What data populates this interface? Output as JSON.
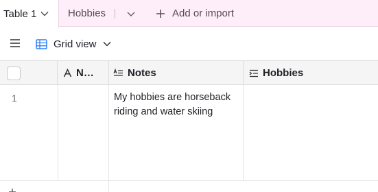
{
  "tabs": {
    "active_label": "Table 1",
    "second_label": "Hobbies",
    "add_import_label": "Add or import"
  },
  "toolbar": {
    "view_label": "Grid view"
  },
  "grid": {
    "columns": [
      {
        "label": "N…",
        "icon": "text-a-icon"
      },
      {
        "label": "Notes",
        "icon": "long-text-icon"
      },
      {
        "label": "Hobbies",
        "icon": "long-text-indent-icon"
      }
    ],
    "rows": [
      {
        "number": "1",
        "name": "",
        "notes": "My hobbies are horseback riding and water skiing",
        "hobbies": ""
      }
    ]
  },
  "colors": {
    "tab_bar_bg": "#fdeefa",
    "header_bg": "#f5f5f5",
    "grid_icon": "#2d7ff9"
  }
}
